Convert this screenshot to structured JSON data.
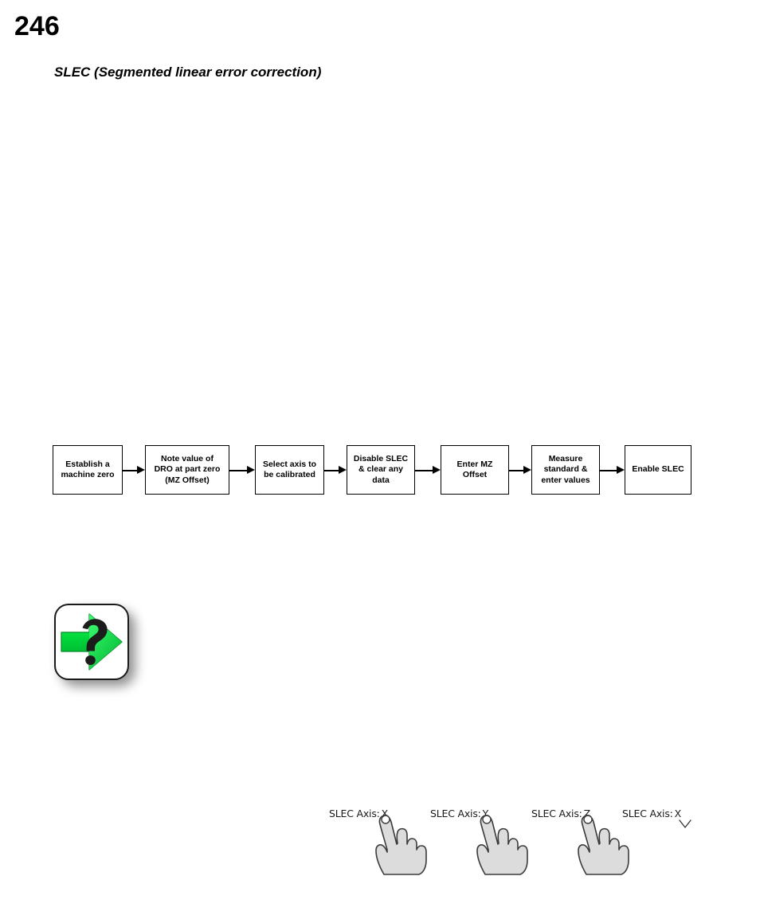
{
  "page": {
    "number": "246",
    "section_title": "SLEC (Segmented linear error correction)"
  },
  "flowchart": {
    "steps": [
      {
        "label": "Establish a\nmachine zero"
      },
      {
        "label": "Note value of\nDRO at part zero\n(MZ Offset)"
      },
      {
        "label": "Select axis to\nbe calibrated"
      },
      {
        "label": "Disable SLEC\n& clear any\ndata"
      },
      {
        "label": "Enter MZ\nOffset"
      },
      {
        "label": "Measure\nstandard &\nenter values"
      },
      {
        "label": "Enable SLEC"
      }
    ]
  },
  "hint_icon": {
    "name": "green-arrow-question-icon",
    "arrow_color": "#00d83c",
    "arrow_color_dark": "#00a62c",
    "question_color": "#1a1a1a",
    "plate_color": "#ffffff"
  },
  "axis_selector": {
    "label_prefix": "SLEC Axis:",
    "items": [
      {
        "prefix": "SLEC Axis:",
        "value": "X",
        "has_hand": true
      },
      {
        "prefix": "SLEC Axis:",
        "value": "Y",
        "has_hand": true
      },
      {
        "prefix": "SLEC Axis:",
        "value": "Z",
        "has_hand": true
      },
      {
        "prefix": "SLEC Axis:",
        "value": "X",
        "has_hand": false
      }
    ]
  }
}
